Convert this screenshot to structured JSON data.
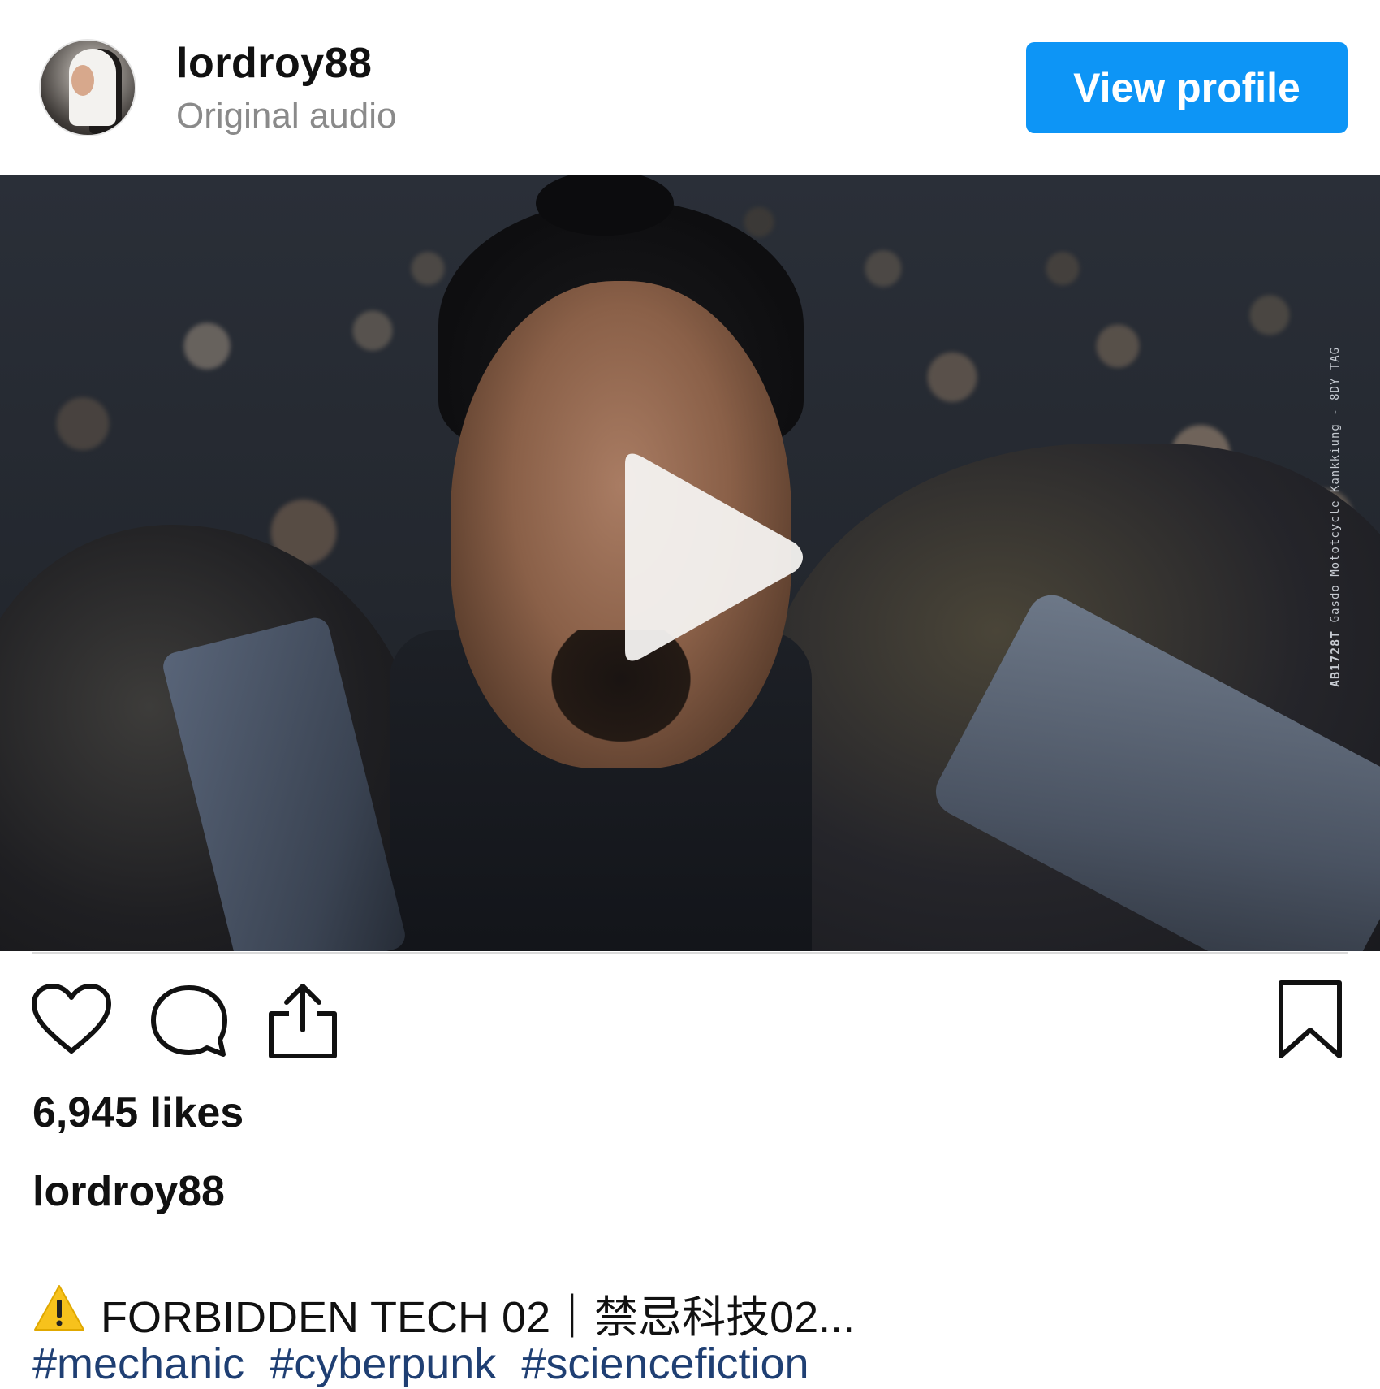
{
  "header": {
    "username": "lordroy88",
    "subtitle": "Original audio",
    "view_profile_label": "View profile"
  },
  "video": {
    "side_text_code": "AB1728T",
    "side_text_small": "Gasdo Mototcycle Kankkiung - 8DY TAG"
  },
  "actions": {
    "icons": [
      "heart-icon",
      "comment-icon",
      "share-icon",
      "bookmark-icon"
    ]
  },
  "post": {
    "likes": "6,945 likes",
    "caption_user": "lordroy88",
    "caption_title": "FORBIDDEN TECH 02｜禁忌科技02...",
    "hashtags": [
      "#mechanic",
      "#cyberpunk",
      "#sciencefiction"
    ]
  },
  "colors": {
    "accent": "#0d95f6",
    "hashtag": "#1f3f73",
    "muted": "#8a8a8a"
  }
}
